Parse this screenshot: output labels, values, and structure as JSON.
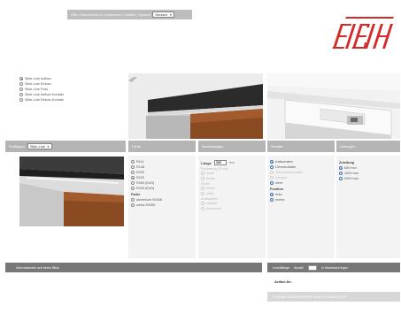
{
  "nav": {
    "links": "Hilfe | Datenschutz & | Impressum | Kontakt | Sprache",
    "language": "Deutsch"
  },
  "product_lines": [
    {
      "label": "Slide-Line Aufbau",
      "selected": true
    },
    {
      "label": "Slide-Line Einbau",
      "selected": false
    },
    {
      "label": "Slide-Line Fuss",
      "selected": false
    },
    {
      "label": "Slide-Line Aufbau Kontakt",
      "selected": false
    },
    {
      "label": "Slide-Line Einbau Kontakt",
      "selected": false
    }
  ],
  "product_header": {
    "label": "Profiltypen",
    "select_value": "Slide-Line"
  },
  "columns": {
    "color": {
      "title": "Farbe",
      "options": [
        {
          "label": "R111",
          "selected": false
        },
        {
          "label": "R148",
          "selected": false
        },
        {
          "label": "R150",
          "selected": false
        },
        {
          "label": "R220",
          "selected": true
        },
        {
          "label": "R250 (EnO)",
          "selected": false
        },
        {
          "label": "R150 (EnO)",
          "selected": false
        }
      ],
      "sub_title": "Farbe",
      "sub_options": [
        {
          "label": "aluminium 5000K",
          "selected": false
        },
        {
          "label": "weiss 3000K",
          "selected": false
        }
      ]
    },
    "size": {
      "title": "Abmessungen",
      "length_label": "Länge",
      "length_value": "350",
      "length_unit": "mm",
      "groups": [
        {
          "label": "Einfassung (Front)",
          "options": [
            "innen",
            "Kante"
          ]
        },
        {
          "label": "Farbe",
          "options": [
            "weiss",
            "silber"
          ]
        },
        {
          "label": "Aufbauteile",
          "options": [
            "vertikal",
            "horizontal"
          ]
        }
      ]
    },
    "handle": {
      "title": "Schalter",
      "options": [
        {
          "label": "Kaltschalter",
          "selected": true,
          "disabled": false
        },
        {
          "label": "Dimmschalter",
          "selected": false,
          "disabled": false
        },
        {
          "label": "Türkontaktschalter",
          "selected": false,
          "disabled": true
        },
        {
          "label": "Kontakt",
          "selected": false,
          "disabled": true
        },
        {
          "label": "ohne",
          "selected": false,
          "disabled": false
        }
      ],
      "position_title": "Position",
      "position_options": [
        {
          "label": "links",
          "selected": true
        },
        {
          "label": "rechts",
          "selected": false
        }
      ]
    },
    "length": {
      "title": "Leitungen",
      "sub_title": "Zuleitung",
      "options": [
        {
          "label": "600 mm",
          "selected": true
        },
        {
          "label": "1000 mm",
          "selected": false
        },
        {
          "label": "2000 mm",
          "selected": false
        }
      ]
    }
  },
  "footer": {
    "info_text": "Informationen auf einen Blick",
    "pager_left": "Leuchtlänge",
    "pager_middle": "Anzahl",
    "pager_input": "",
    "pager_right": "In Warenkorb legen",
    "article_label": "Artikel-Nr.:",
    "info_bar": "PLUS BEI IN BAUGRUPPEN HALB FIX SANGEN NOT"
  },
  "colors": {
    "bar_grey": "#b5b5b5",
    "dark_bar": "#777777",
    "logo_red": "#d42a2a"
  }
}
